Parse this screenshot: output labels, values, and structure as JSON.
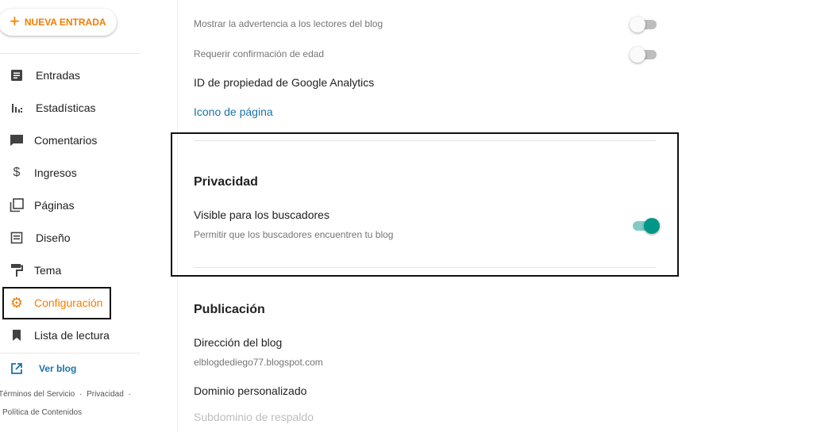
{
  "sidebar": {
    "new_entry_label": "NUEVA ENTRADA",
    "items": [
      {
        "label": "Entradas",
        "icon": "posts-icon"
      },
      {
        "label": "Estadísticas",
        "icon": "stats-icon"
      },
      {
        "label": "Comentarios",
        "icon": "comments-icon"
      },
      {
        "label": "Ingresos",
        "icon": "dollar-icon"
      },
      {
        "label": "Páginas",
        "icon": "pages-icon"
      },
      {
        "label": "Diseño",
        "icon": "layout-icon"
      },
      {
        "label": "Tema",
        "icon": "theme-icon"
      },
      {
        "label": "Configuración",
        "icon": "gear-icon",
        "active": true
      },
      {
        "label": "Lista de lectura",
        "icon": "bookmark-icon"
      }
    ],
    "view_blog_label": "Ver blog",
    "footer": {
      "terms": "Términos del Servicio",
      "sep": "·",
      "privacy": "Privacidad",
      "policy": "Política de Contenidos"
    }
  },
  "main": {
    "warning_readers_label": "Mostrar la advertencia a los lectores del blog",
    "age_confirm_label": "Requerir confirmación de edad",
    "analytics_label": "ID de propiedad de Google Analytics",
    "favicon_label": "Icono de página",
    "privacy": {
      "title": "Privacidad",
      "visible_label": "Visible para los buscadores",
      "visible_sub": "Permitir que los buscadores encuentren tu blog",
      "visible_on": true
    },
    "publishing": {
      "title": "Publicación",
      "address_label": "Dirección del blog",
      "address_value": "elblogdediego77.blogspot.com",
      "custom_domain_label": "Dominio personalizado",
      "fallback_label": "Subdominio de respaldo"
    }
  },
  "colors": {
    "accent": "#f57c00",
    "link": "#1a73a8",
    "toggle_on": "#009688"
  }
}
